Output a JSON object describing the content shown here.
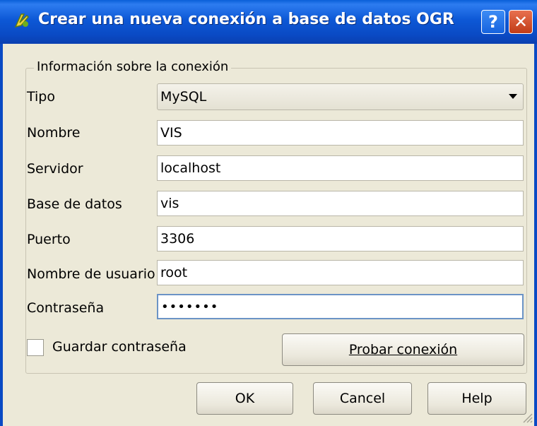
{
  "window": {
    "title": "Crear una nueva conexión a base de datos OGR",
    "help_glyph": "?",
    "close_glyph": "✕"
  },
  "group": {
    "legend": "Información sobre la conexión"
  },
  "fields": {
    "tipo": {
      "label": "Tipo",
      "value": "MySQL"
    },
    "nombre": {
      "label": "Nombre",
      "value": "VIS"
    },
    "servidor": {
      "label": "Servidor",
      "value": "localhost"
    },
    "base": {
      "label": "Base de datos",
      "value": "vis"
    },
    "puerto": {
      "label": "Puerto",
      "value": "3306"
    },
    "usuario": {
      "label": "Nombre de usuario",
      "value": "root"
    },
    "contrasena": {
      "label": "Contraseña",
      "value": "•••••••"
    }
  },
  "save_password": {
    "label": "Guardar contraseña",
    "checked": false
  },
  "buttons": {
    "test": "Probar conexión",
    "ok": "OK",
    "cancel": "Cancel",
    "help": "Help"
  },
  "colors": {
    "titlebar": "#0a4ac4",
    "dialog_bg": "#ece9d8",
    "close_button": "#c13c17"
  }
}
